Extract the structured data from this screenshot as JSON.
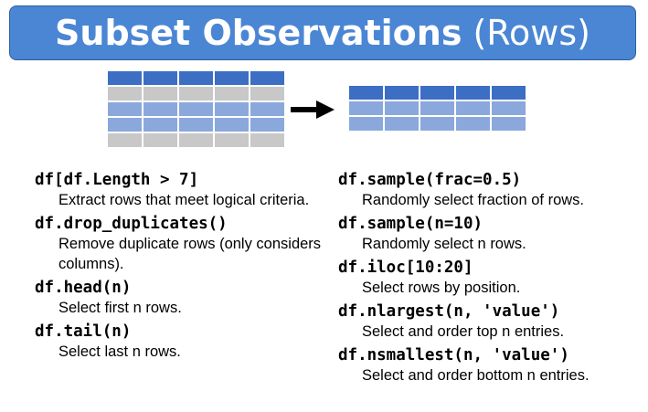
{
  "title": {
    "bold_part": "Subset Observations",
    "light_part": "(Rows)"
  },
  "colors": {
    "banner": "#4a86d4",
    "header_row": "#3c6ec4",
    "selected_row": "#8aa8dc",
    "unselected_row": "#c8c8c8",
    "arrow": "#000000"
  },
  "diagram": {
    "source_table": {
      "columns": 5,
      "rows": [
        "header",
        "unselected",
        "selected",
        "selected",
        "unselected"
      ]
    },
    "result_table": {
      "columns": 5,
      "rows": [
        "header",
        "selected",
        "selected"
      ]
    }
  },
  "left_entries": [
    {
      "code": "df[df.Length > 7]",
      "desc": "Extract rows that meet logical criteria."
    },
    {
      "code": "df.drop_duplicates()",
      "desc": "Remove duplicate rows (only considers columns)."
    },
    {
      "code": "df.head(n)",
      "desc": "Select first n rows."
    },
    {
      "code": "df.tail(n)",
      "desc": "Select last n rows."
    }
  ],
  "right_entries": [
    {
      "code": "df.sample(frac=0.5)",
      "desc": "Randomly select fraction of rows."
    },
    {
      "code": "df.sample(n=10)",
      "desc": "Randomly select n rows."
    },
    {
      "code": "df.iloc[10:20]",
      "desc": "Select rows by position."
    },
    {
      "code": "df.nlargest(n, 'value')",
      "desc": "Select and order top n entries."
    },
    {
      "code": "df.nsmallest(n, 'value')",
      "desc": "Select and order bottom n entries."
    }
  ]
}
